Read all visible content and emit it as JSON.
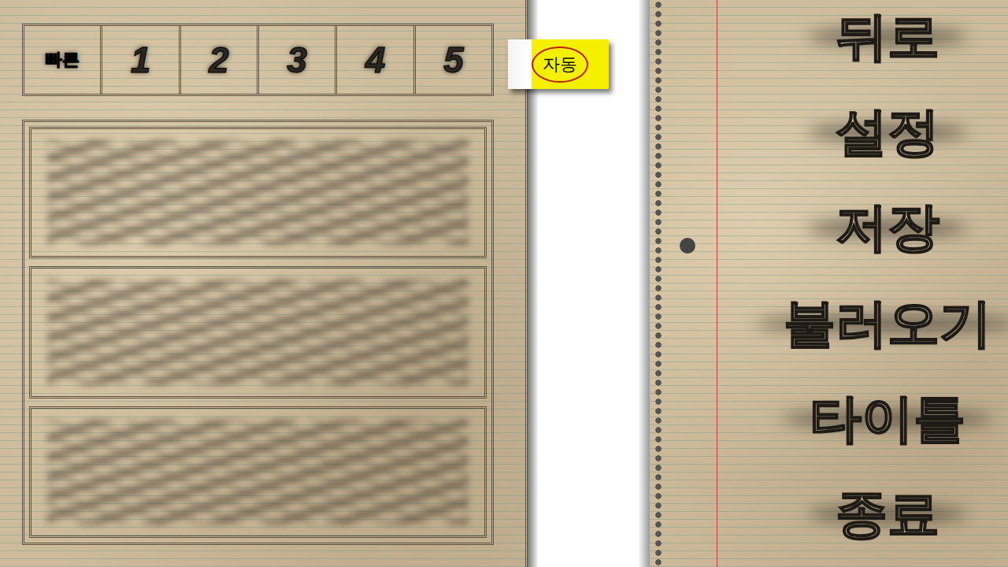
{
  "tabs": [
    {
      "label": "빠른",
      "selected": false,
      "kind": "cell"
    },
    {
      "label": "1",
      "selected": false,
      "kind": "cell"
    },
    {
      "label": "2",
      "selected": false,
      "kind": "cell"
    },
    {
      "label": "3",
      "selected": false,
      "kind": "cell"
    },
    {
      "label": "4",
      "selected": false,
      "kind": "cell"
    },
    {
      "label": "5",
      "selected": false,
      "kind": "cell"
    },
    {
      "label": "자동",
      "selected": true,
      "kind": "sticky"
    }
  ],
  "slots": [
    {
      "kind": "scribbled"
    },
    {
      "kind": "scribbled"
    },
    {
      "kind": "scribbled"
    }
  ],
  "menu": [
    {
      "label": "뒤로"
    },
    {
      "label": "설정"
    },
    {
      "label": "저장"
    },
    {
      "label": "불러오기"
    },
    {
      "label": "타이틀"
    },
    {
      "label": "종료"
    }
  ]
}
